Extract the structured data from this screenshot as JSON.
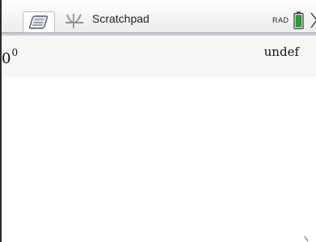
{
  "window": {
    "title": "Scratchpad",
    "angle_mode": "RAD"
  },
  "icons": {
    "calculator_tab": "calculator-icon",
    "graph_tab": "graph-icon",
    "battery": "battery-icon",
    "menu_arrow": "chevron-right-icon"
  },
  "colors": {
    "battery_fill": "#2e9b2e",
    "graph_icon": "#8a8f96",
    "calc_icon": "#5b6470"
  },
  "history": [
    {
      "base": "0",
      "exponent": "0",
      "result": "undef"
    }
  ]
}
